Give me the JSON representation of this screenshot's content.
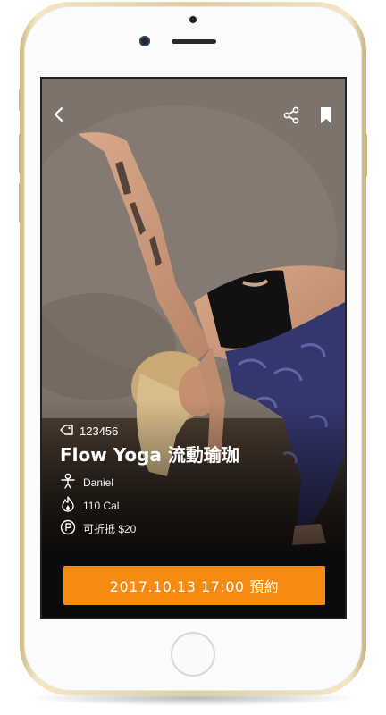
{
  "class": {
    "code": "123456",
    "title": "Flow Yoga 流動瑜珈",
    "instructor": "Daniel",
    "calories": "110 Cal",
    "discount": "可折抵 $20"
  },
  "booking": {
    "button_label": "2017.10.13 17:00 預約"
  },
  "icons": {
    "back": "chevron-left-icon",
    "share": "share-icon",
    "bookmark": "bookmark-icon",
    "tag": "tag-icon",
    "instructor": "person-icon",
    "calories": "flame-icon",
    "points": "p-coin-icon"
  },
  "colors": {
    "accent": "#f68b12",
    "bottom_bar": "#0b0b0b",
    "phone_frame": "#e0cfa0"
  }
}
